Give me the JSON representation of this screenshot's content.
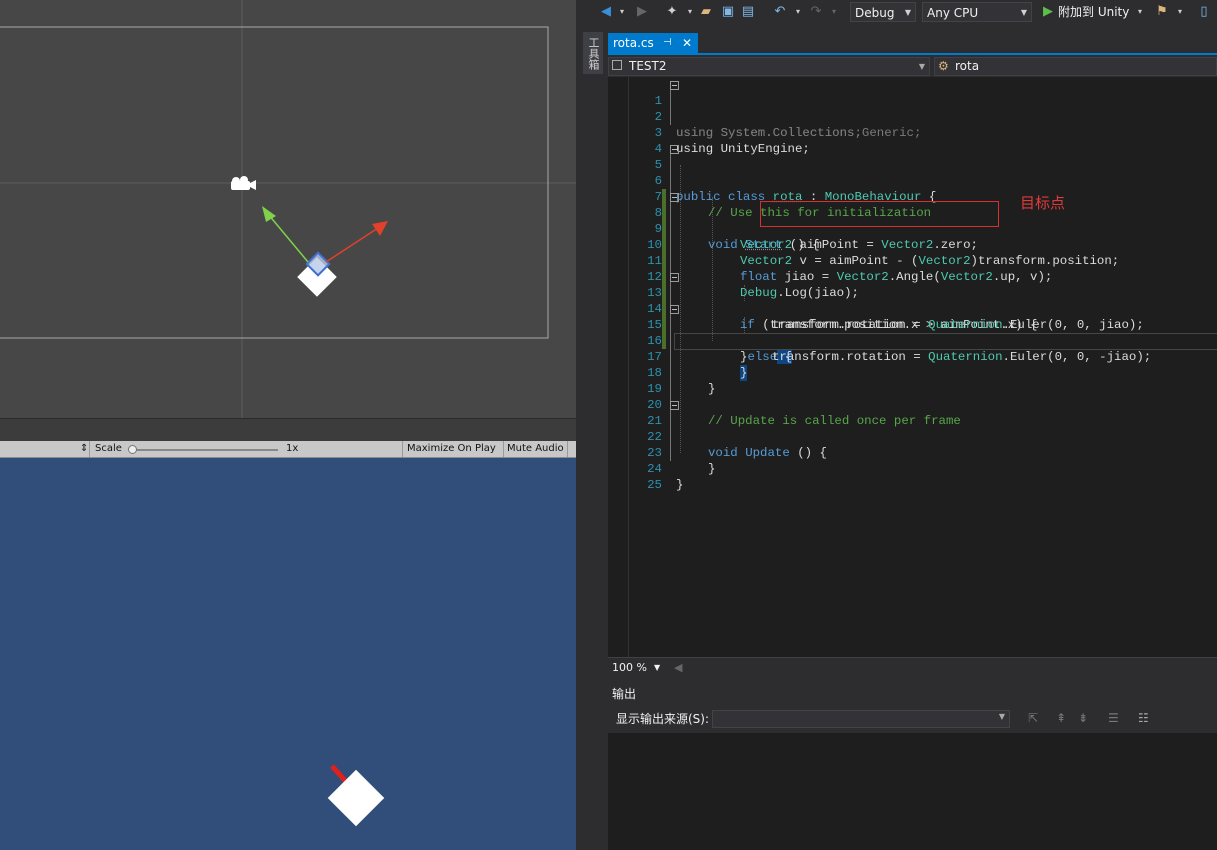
{
  "unity": {
    "game_toolbar": {
      "aspect_arrow": "⇕",
      "scale_label": "Scale",
      "scale_value": "1x",
      "maximize_label": "Maximize On Play",
      "mute_label": "Mute Audio"
    }
  },
  "vs": {
    "toolbar": {
      "config": "Debug",
      "platform": "Any CPU",
      "attach_label": "附加到 Unity"
    },
    "toolbox_tab": "工具箱",
    "doc_tab": {
      "name": "rota.cs",
      "pin": "⊣",
      "close": "✕"
    },
    "nav": {
      "project": "TEST2",
      "class": "rota"
    },
    "code_lines": [
      {
        "n": "1"
      },
      {
        "n": "2"
      },
      {
        "n": "3"
      },
      {
        "n": "4"
      },
      {
        "n": "5"
      },
      {
        "n": "6"
      },
      {
        "n": "7"
      },
      {
        "n": "8"
      },
      {
        "n": "9"
      },
      {
        "n": "10"
      },
      {
        "n": "11"
      },
      {
        "n": "12"
      },
      {
        "n": "13"
      },
      {
        "n": "14"
      },
      {
        "n": "15"
      },
      {
        "n": "16"
      },
      {
        "n": "17"
      },
      {
        "n": "18"
      },
      {
        "n": "19"
      },
      {
        "n": "20"
      },
      {
        "n": "21"
      },
      {
        "n": "22"
      },
      {
        "n": "23"
      },
      {
        "n": "24"
      },
      {
        "n": "25"
      }
    ],
    "code_text": {
      "l1": "using System.Collections;",
      "l2": "using System.Collections.Generic;",
      "l3": "using UnityEngine;",
      "l5_a": "public class ",
      "l5_b": "rota",
      "l5_c": " : ",
      "l5_d": "MonoBehaviour",
      "l5_e": " {",
      "l7": "// Use this for initialization",
      "l8_a": "void ",
      "l8_b": "Start",
      "l8_c": " () {",
      "l9_a": "Vector2",
      "l9_b": " aimPoint = ",
      "l9_c": "Vector2",
      "l9_d": ".zero;",
      "l10_a": "Vector2",
      "l10_b": " v = aimPoint - (",
      "l10_c": "Vector2",
      "l10_d": ")transform.position;",
      "l11_a": "float",
      "l11_b": " jiao = ",
      "l11_c": "Vector2",
      "l11_d": ".Angle(",
      "l11_e": "Vector2",
      "l11_f": ".up, v);",
      "l12_a": "Debug",
      "l12_b": ".Log(jiao);",
      "l13_a": "if",
      "l13_b": " (transform.position.x > aimPoint.x) {",
      "l14_a": "transform.rotation = ",
      "l14_b": "Quaternion",
      "l14_c": ".Euler(0, 0, jiao);",
      "l15_a": "}",
      "l15_b": "else",
      "l15_c": " {",
      "l16_a": "transform.rotation = ",
      "l16_b": "Quaternion",
      "l16_c": ".Euler(0, 0, -jiao);",
      "l17": "}",
      "l18": "}",
      "l20": "// Update is called once per frame",
      "l21_a": "void ",
      "l21_b": "Update",
      "l21_c": " () {",
      "l23": "}",
      "l24": "}"
    },
    "annotation": "目标点",
    "zoom": "100 %",
    "output": {
      "title": "输出",
      "source_label": "显示输出来源(S):",
      "source_value": ""
    }
  }
}
